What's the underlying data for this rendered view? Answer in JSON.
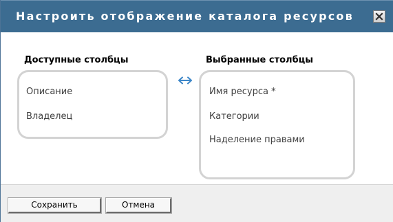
{
  "dialog": {
    "title": "Настроить отображение каталога ресурсов",
    "close_icon": "close-x-icon"
  },
  "available": {
    "heading": "Доступные столбцы",
    "items": [
      "Описание",
      "Владелец"
    ]
  },
  "selected": {
    "heading": "Выбранные столбцы",
    "items": [
      "Имя ресурса *",
      "Категории",
      "Наделение правами"
    ]
  },
  "swap_icon": "double-arrow-icon",
  "footer": {
    "save_label": "Сохранить",
    "cancel_label": "Отмена"
  },
  "colors": {
    "titlebar": "#3c6c91",
    "swap_arrow": "#3c86c8",
    "list_border": "#d3d3d3"
  }
}
